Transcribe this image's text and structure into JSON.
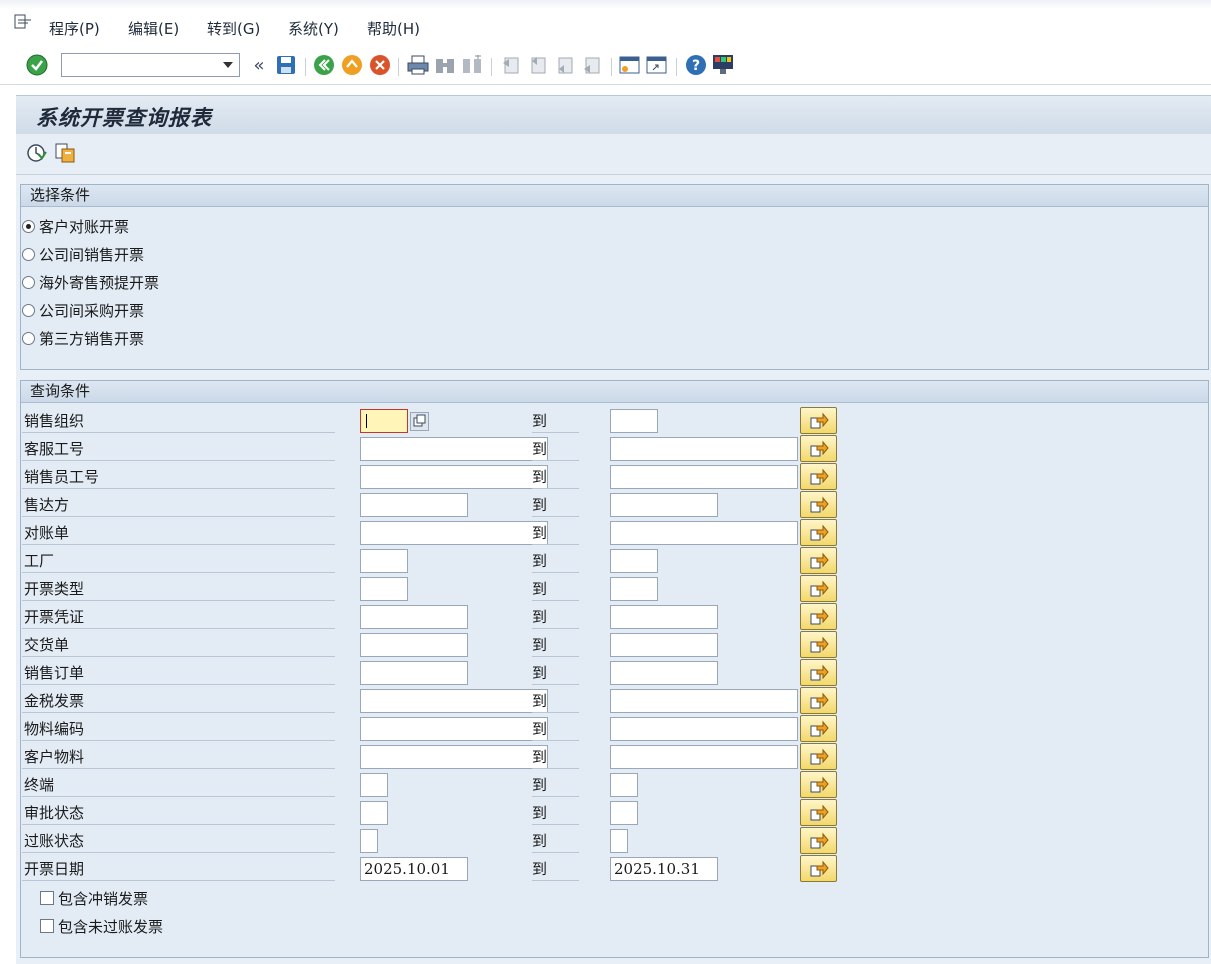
{
  "menu": {
    "items": [
      "程序(P)",
      "编辑(E)",
      "转到(G)",
      "系统(Y)",
      "帮助(H)"
    ]
  },
  "toolbar": {
    "command_value": "",
    "back_glyph": "«"
  },
  "screen": {
    "title": "系统开票查询报表"
  },
  "selection": {
    "header": "选择条件",
    "options": [
      {
        "label": "客户对账开票",
        "selected": true
      },
      {
        "label": "公司间销售开票",
        "selected": false
      },
      {
        "label": "海外寄售预提开票",
        "selected": false
      },
      {
        "label": "公司间采购开票",
        "selected": false
      },
      {
        "label": "第三方销售开票",
        "selected": false
      }
    ]
  },
  "query": {
    "header": "查询条件",
    "to_label": "到",
    "fields": [
      {
        "label": "销售组织",
        "from": "",
        "to": ""
      },
      {
        "label": "客服工号",
        "from": "",
        "to": ""
      },
      {
        "label": "销售员工号",
        "from": "",
        "to": ""
      },
      {
        "label": "售达方",
        "from": "",
        "to": ""
      },
      {
        "label": "对账单",
        "from": "",
        "to": ""
      },
      {
        "label": "工厂",
        "from": "",
        "to": ""
      },
      {
        "label": "开票类型",
        "from": "",
        "to": ""
      },
      {
        "label": "开票凭证",
        "from": "",
        "to": ""
      },
      {
        "label": "交货单",
        "from": "",
        "to": ""
      },
      {
        "label": "销售订单",
        "from": "",
        "to": ""
      },
      {
        "label": "金税发票",
        "from": "",
        "to": ""
      },
      {
        "label": "物料编码",
        "from": "",
        "to": ""
      },
      {
        "label": "客户物料",
        "from": "",
        "to": ""
      },
      {
        "label": "终端",
        "from": "",
        "to": ""
      },
      {
        "label": "审批状态",
        "from": "",
        "to": ""
      },
      {
        "label": "过账状态",
        "from": "",
        "to": ""
      },
      {
        "label": "开票日期",
        "from": "2025.10.01",
        "to": "2025.10.31"
      }
    ],
    "checkboxes": [
      {
        "label": "包含冲销发票",
        "checked": false
      },
      {
        "label": "包含未过账发票",
        "checked": false
      }
    ]
  },
  "colors": {
    "accent_yellow": "#f3d86a",
    "panel": "#e3ecf5",
    "title_bar": "#cfdbe8"
  }
}
